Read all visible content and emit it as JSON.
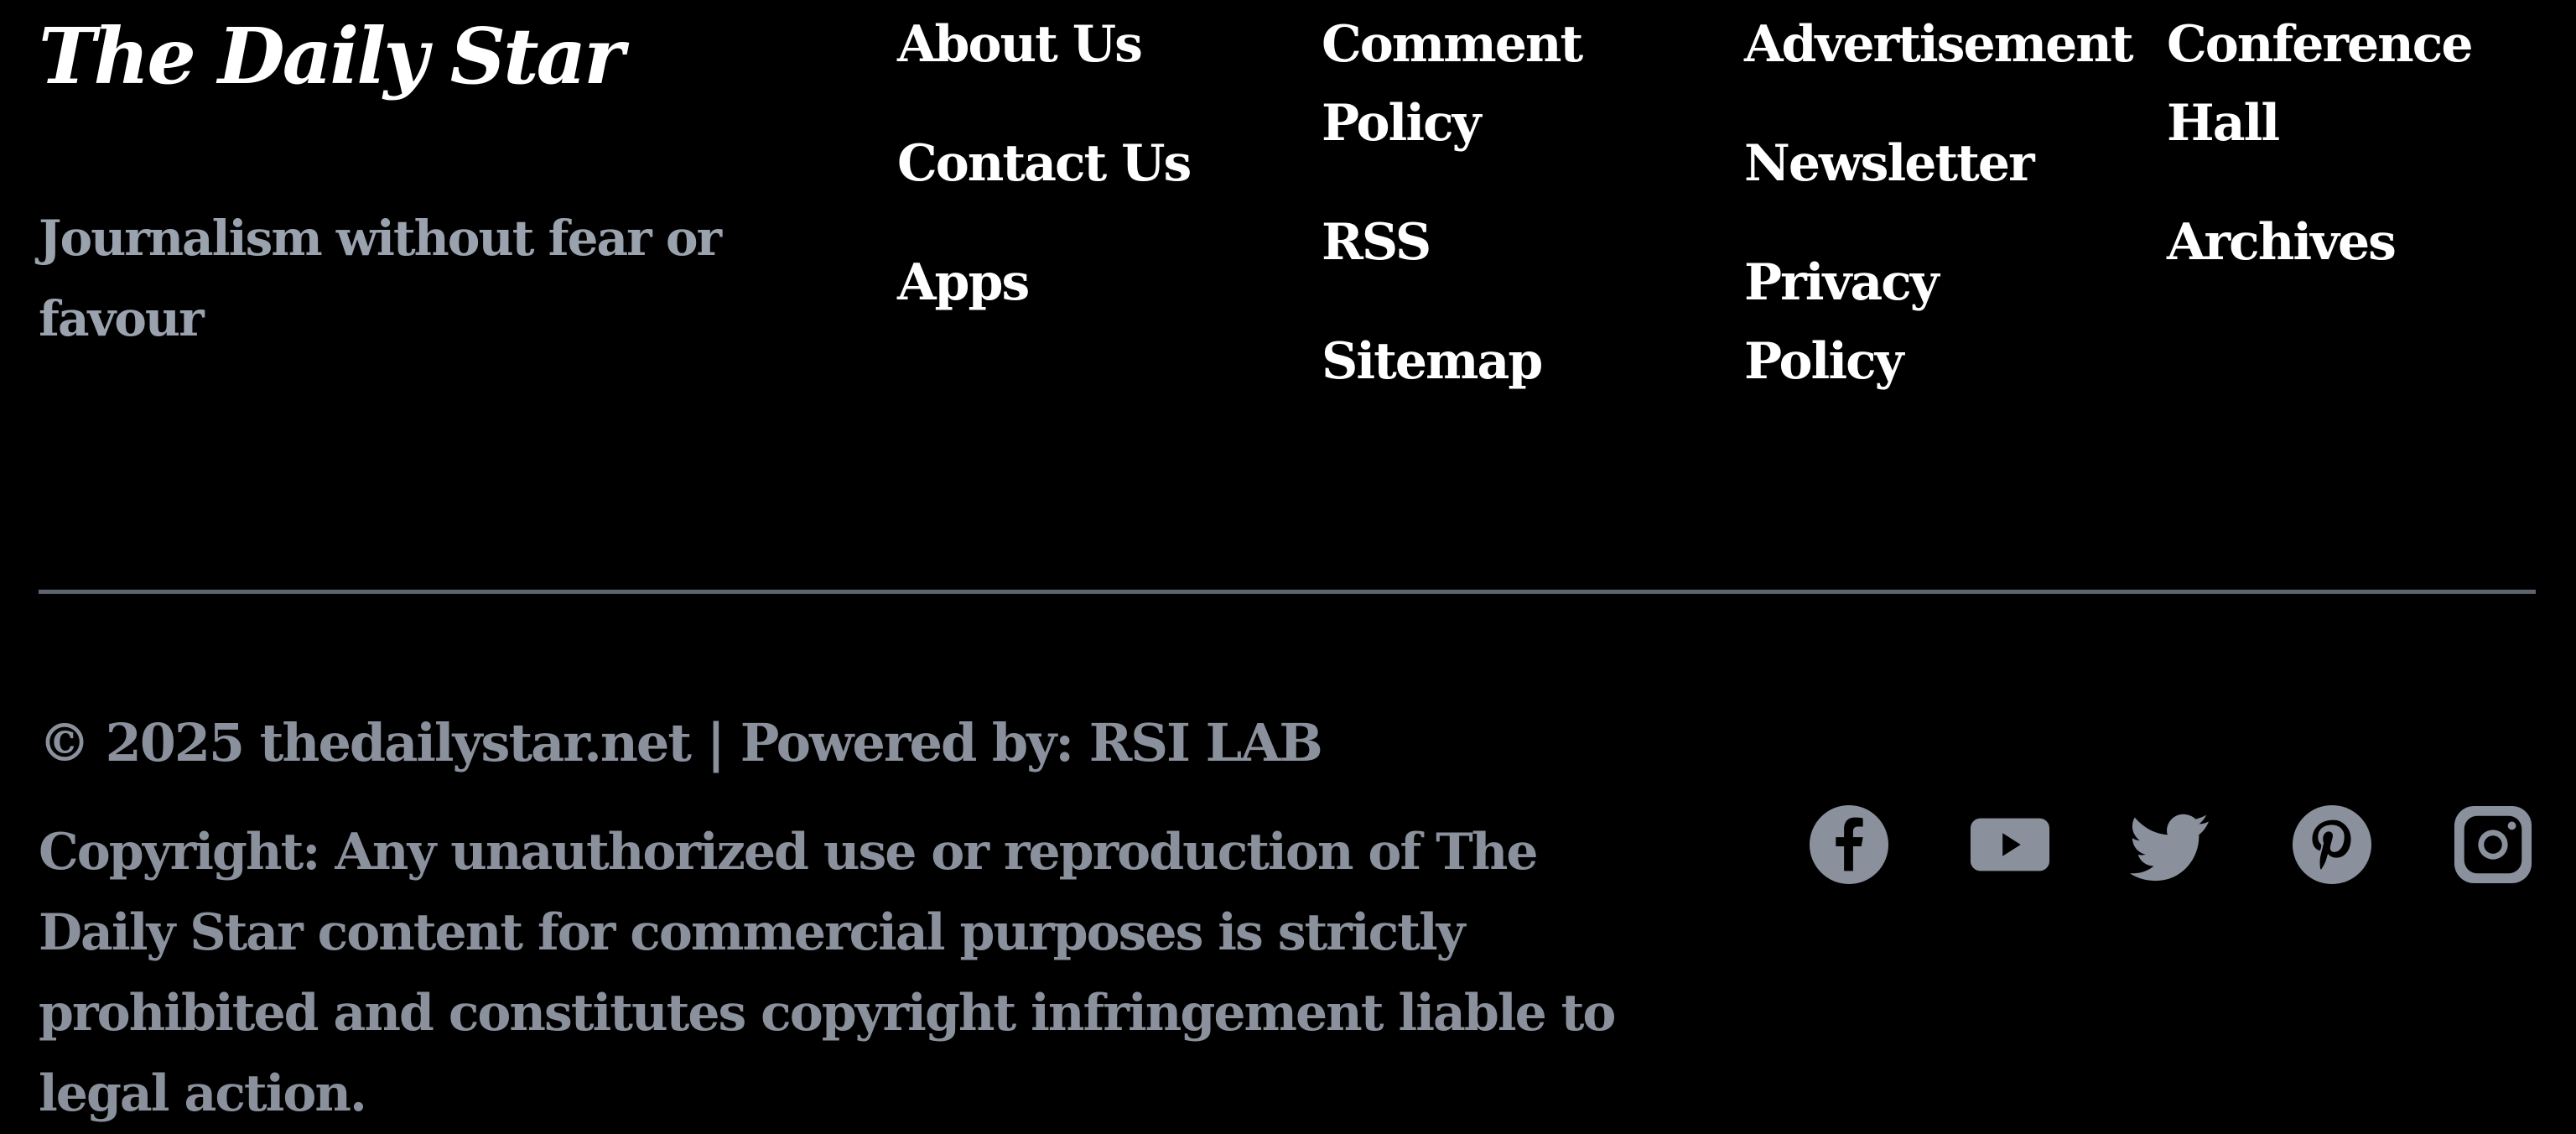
{
  "footer": {
    "logo_text": "The Daily Star",
    "tagline": "Journalism without fear or favour",
    "columns": [
      {
        "links": [
          "About Us",
          "Contact Us",
          "Apps"
        ]
      },
      {
        "links": [
          "Comment Policy",
          "RSS",
          "Sitemap"
        ]
      },
      {
        "links": [
          "Advertisement",
          "Newsletter",
          "Privacy Policy"
        ]
      },
      {
        "links": [
          "Conference Hall",
          "Archives"
        ]
      }
    ],
    "copyright_line": "© 2025 thedailystar.net | Powered by: RSI LAB",
    "disclaimer": "Copyright: Any unauthorized use or reproduction of The Daily Star content for commercial purposes is strictly prohibited and constitutes copyright infringement liable to legal action.",
    "social_icons": [
      "facebook-icon",
      "youtube-icon",
      "twitter-icon",
      "pinterest-icon",
      "instagram-icon"
    ],
    "colors": {
      "background": "#000000",
      "link": "#ffffff",
      "muted": "#8a919c",
      "divider": "#5d6470"
    }
  }
}
